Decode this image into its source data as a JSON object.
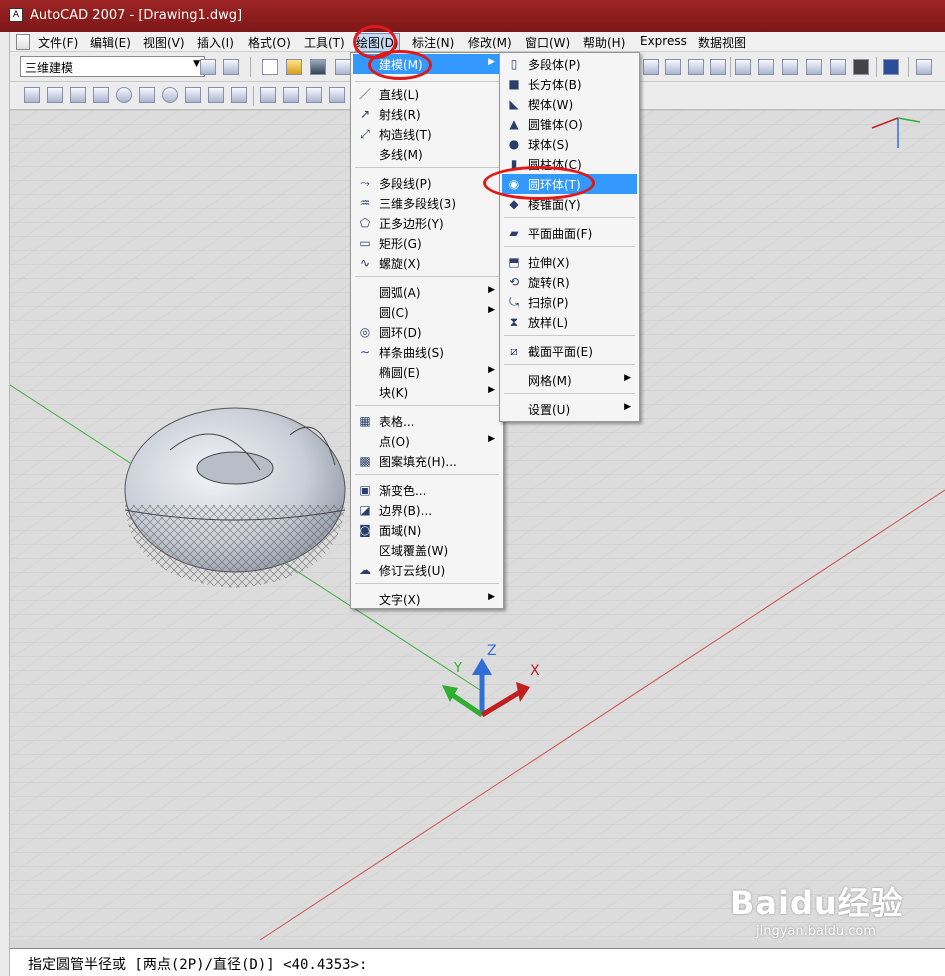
{
  "window": {
    "title": "AutoCAD 2007 - [Drawing1.dwg]",
    "app_icon": "A"
  },
  "menubar": [
    {
      "label": "文件(F)"
    },
    {
      "label": "编辑(E)"
    },
    {
      "label": "视图(V)"
    },
    {
      "label": "插入(I)"
    },
    {
      "label": "格式(O)"
    },
    {
      "label": "工具(T)"
    },
    {
      "label": "绘图(D)"
    },
    {
      "label": "标注(N)"
    },
    {
      "label": "修改(M)"
    },
    {
      "label": "窗口(W)"
    },
    {
      "label": "帮助(H)"
    },
    {
      "label": "Express"
    },
    {
      "label": "数据视图"
    }
  ],
  "toolbar": {
    "workspace": "三维建模"
  },
  "draw_menu": {
    "items": [
      {
        "label": "建模(M)",
        "icon": "cube-icon",
        "submenu": true
      },
      {
        "label": "直线(L)",
        "icon": "line-icon"
      },
      {
        "label": "射线(R)",
        "icon": "ray-icon"
      },
      {
        "label": "构造线(T)",
        "icon": "xline-icon"
      },
      {
        "label": "多线(M)",
        "icon": ""
      },
      {
        "label": "多段线(P)",
        "icon": "polyline-icon"
      },
      {
        "label": "三维多段线(3)",
        "icon": "3dpoly-icon"
      },
      {
        "label": "正多边形(Y)",
        "icon": "polygon-icon"
      },
      {
        "label": "矩形(G)",
        "icon": "rectangle-icon"
      },
      {
        "label": "螺旋(X)",
        "icon": "helix-icon"
      },
      {
        "label": "圆弧(A)",
        "icon": "",
        "submenu": true
      },
      {
        "label": "圆(C)",
        "icon": "",
        "submenu": true
      },
      {
        "label": "圆环(D)",
        "icon": "donut-icon"
      },
      {
        "label": "样条曲线(S)",
        "icon": "spline-icon"
      },
      {
        "label": "椭圆(E)",
        "icon": "",
        "submenu": true
      },
      {
        "label": "块(K)",
        "icon": "",
        "submenu": true
      },
      {
        "label": "表格...",
        "icon": "table-icon"
      },
      {
        "label": "点(O)",
        "icon": "",
        "submenu": true
      },
      {
        "label": "图案填充(H)...",
        "icon": "hatch-icon"
      },
      {
        "label": "渐变色...",
        "icon": "gradient-icon"
      },
      {
        "label": "边界(B)...",
        "icon": "boundary-icon"
      },
      {
        "label": "面域(N)",
        "icon": "region-icon"
      },
      {
        "label": "区域覆盖(W)",
        "icon": ""
      },
      {
        "label": "修订云线(U)",
        "icon": "revcloud-icon"
      },
      {
        "label": "文字(X)",
        "icon": "",
        "submenu": true
      }
    ]
  },
  "modeling_menu": {
    "items": [
      {
        "label": "多段体(P)",
        "icon": "polysolid-icon"
      },
      {
        "label": "长方体(B)",
        "icon": "box-icon"
      },
      {
        "label": "楔体(W)",
        "icon": "wedge-icon"
      },
      {
        "label": "圆锥体(O)",
        "icon": "cone-icon"
      },
      {
        "label": "球体(S)",
        "icon": "sphere-icon"
      },
      {
        "label": "圆柱体(C)",
        "icon": "cylinder-icon"
      },
      {
        "label": "圆环体(T)",
        "icon": "torus-icon"
      },
      {
        "label": "棱锥面(Y)",
        "icon": "pyramid-icon"
      },
      {
        "label": "平面曲面(F)",
        "icon": "planesurf-icon"
      },
      {
        "label": "拉伸(X)",
        "icon": "extrude-icon"
      },
      {
        "label": "旋转(R)",
        "icon": "revolve-icon"
      },
      {
        "label": "扫掠(P)",
        "icon": "sweep-icon"
      },
      {
        "label": "放样(L)",
        "icon": "loft-icon"
      },
      {
        "label": "截面平面(E)",
        "icon": "section-icon"
      },
      {
        "label": "网格(M)",
        "icon": "",
        "submenu": true
      },
      {
        "label": "设置(U)",
        "icon": "",
        "submenu": true
      }
    ]
  },
  "ucs": {
    "x": "X",
    "y": "Y",
    "z": "Z"
  },
  "command_line": "指定圆管半径或 [两点(2P)/直径(D)] <40.4353>:",
  "watermark": {
    "brand": "Baidu经验",
    "url": "jingyan.baidu.com"
  }
}
